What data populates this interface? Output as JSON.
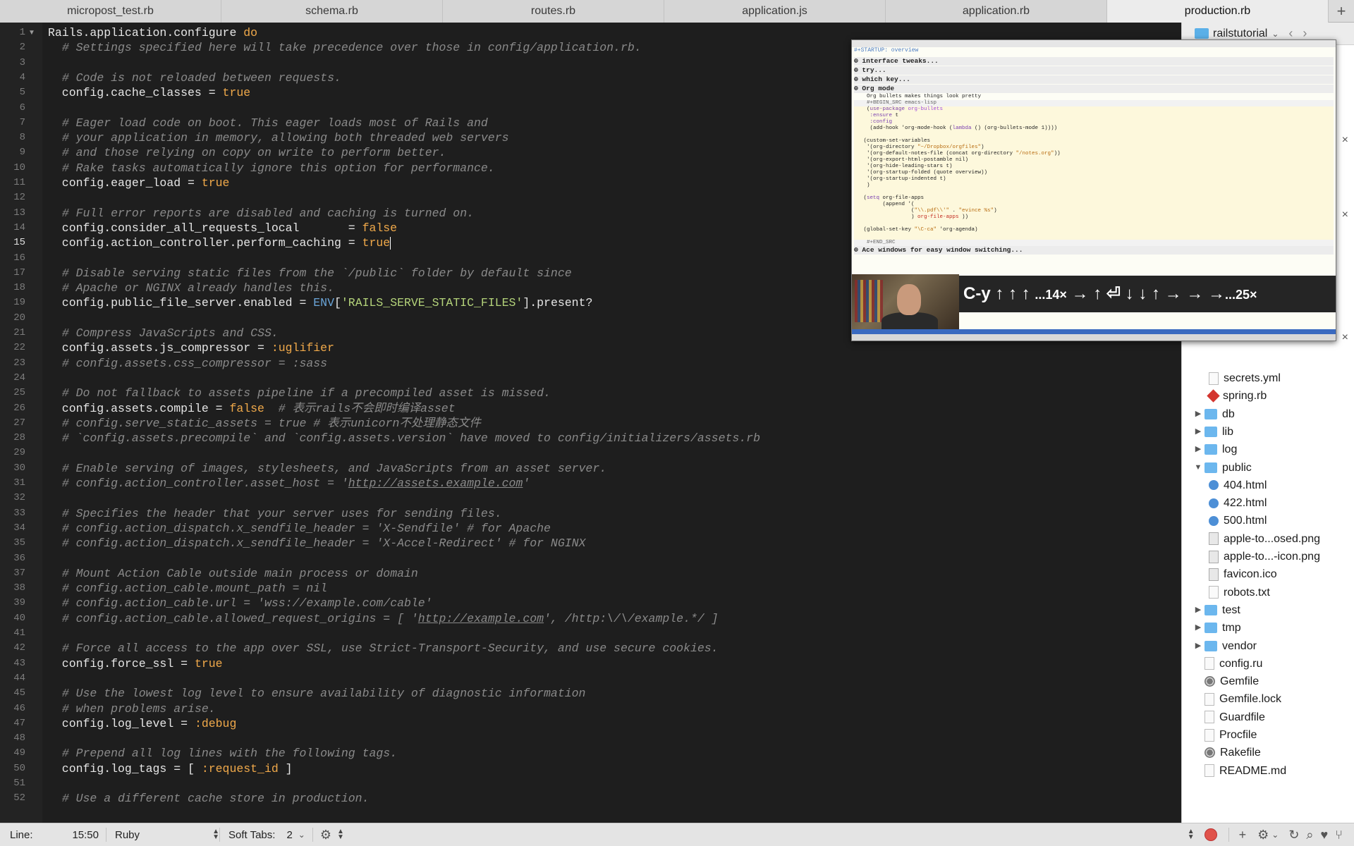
{
  "tabs": [
    {
      "label": "micropost_test.rb"
    },
    {
      "label": "schema.rb"
    },
    {
      "label": "routes.rb"
    },
    {
      "label": "application.js"
    },
    {
      "label": "application.rb"
    },
    {
      "label": "production.rb"
    }
  ],
  "active_tab": "production.rb",
  "editor": {
    "current_line": 15,
    "lines": [
      {
        "n": "1",
        "html": "Rails.application.configure <span class='kw'>do</span>"
      },
      {
        "n": "2",
        "html": "  <span class='cm'># Settings specified here will take precedence over those in config/application.rb.</span>"
      },
      {
        "n": "3",
        "html": ""
      },
      {
        "n": "4",
        "html": "  <span class='cm'># Code is not reloaded between requests.</span>"
      },
      {
        "n": "5",
        "html": "  config.cache_classes = <span class='kw'>true</span>"
      },
      {
        "n": "6",
        "html": ""
      },
      {
        "n": "7",
        "html": "  <span class='cm'># Eager load code on boot. This eager loads most of Rails and</span>"
      },
      {
        "n": "8",
        "html": "  <span class='cm'># your application in memory, allowing both threaded web servers</span>"
      },
      {
        "n": "9",
        "html": "  <span class='cm'># and those relying on copy on write to perform better.</span>"
      },
      {
        "n": "10",
        "html": "  <span class='cm'># Rake tasks automatically ignore this option for performance.</span>"
      },
      {
        "n": "11",
        "html": "  config.eager_load = <span class='kw'>true</span>"
      },
      {
        "n": "12",
        "html": ""
      },
      {
        "n": "13",
        "html": "  <span class='cm'># Full error reports are disabled and caching is turned on.</span>"
      },
      {
        "n": "14",
        "html": "  config.consider_all_requests_local       = <span class='kw'>false</span>"
      },
      {
        "n": "15",
        "html": "  config.action_controller.perform_caching = <span class='kw'>true</span><span class='caret'></span>"
      },
      {
        "n": "16",
        "html": ""
      },
      {
        "n": "17",
        "html": "  <span class='cm'># Disable serving static files from the `/public` folder by default since</span>"
      },
      {
        "n": "18",
        "html": "  <span class='cm'># Apache or NGINX already handles this.</span>"
      },
      {
        "n": "19",
        "html": "  config.public_file_server.enabled = <span class='const'>ENV</span>[<span class='str'>'RAILS_SERVE_STATIC_FILES'</span>].present?"
      },
      {
        "n": "20",
        "html": ""
      },
      {
        "n": "21",
        "html": "  <span class='cm'># Compress JavaScripts and CSS.</span>"
      },
      {
        "n": "22",
        "html": "  config.assets.js_compressor = <span class='sym'>:uglifier</span>"
      },
      {
        "n": "23",
        "html": "  <span class='cm'># config.assets.css_compressor = :sass</span>"
      },
      {
        "n": "24",
        "html": ""
      },
      {
        "n": "25",
        "html": "  <span class='cm'># Do not fallback to assets pipeline if a precompiled asset is missed.</span>"
      },
      {
        "n": "26",
        "html": "  config.assets.compile = <span class='kw'>false</span>  <span class='cm'># 表示rails不会即时编译asset</span>"
      },
      {
        "n": "27",
        "html": "  <span class='cm'># config.serve_static_assets = true # 表示unicorn不处理静态文件</span>"
      },
      {
        "n": "28",
        "html": "  <span class='cm'># `config.assets.precompile` and `config.assets.version` have moved to config/initializers/assets.rb</span>"
      },
      {
        "n": "29",
        "html": ""
      },
      {
        "n": "30",
        "html": "  <span class='cm'># Enable serving of images, stylesheets, and JavaScripts from an asset server.</span>"
      },
      {
        "n": "31",
        "html": "  <span class='cm'># config.action_controller.asset_host = '<span class='url'>http://assets.example.com</span>'</span>"
      },
      {
        "n": "32",
        "html": ""
      },
      {
        "n": "33",
        "html": "  <span class='cm'># Specifies the header that your server uses for sending files.</span>"
      },
      {
        "n": "34",
        "html": "  <span class='cm'># config.action_dispatch.x_sendfile_header = 'X-Sendfile' # for Apache</span>"
      },
      {
        "n": "35",
        "html": "  <span class='cm'># config.action_dispatch.x_sendfile_header = 'X-Accel-Redirect' # for NGINX</span>"
      },
      {
        "n": "36",
        "html": ""
      },
      {
        "n": "37",
        "html": "  <span class='cm'># Mount Action Cable outside main process or domain</span>"
      },
      {
        "n": "38",
        "html": "  <span class='cm'># config.action_cable.mount_path = nil</span>"
      },
      {
        "n": "39",
        "html": "  <span class='cm'># config.action_cable.url = 'wss://example.com/cable'</span>"
      },
      {
        "n": "40",
        "html": "  <span class='cm'># config.action_cable.allowed_request_origins = [ '<span class='url'>http://example.com</span>', /http:\\/\\/example.*/ ]</span>"
      },
      {
        "n": "41",
        "html": ""
      },
      {
        "n": "42",
        "html": "  <span class='cm'># Force all access to the app over SSL, use Strict-Transport-Security, and use secure cookies.</span>"
      },
      {
        "n": "43",
        "html": "  config.force_ssl = <span class='kw'>true</span>"
      },
      {
        "n": "44",
        "html": ""
      },
      {
        "n": "45",
        "html": "  <span class='cm'># Use the lowest log level to ensure availability of diagnostic information</span>"
      },
      {
        "n": "46",
        "html": "  <span class='cm'># when problems arise.</span>"
      },
      {
        "n": "47",
        "html": "  config.log_level = <span class='sym'>:debug</span>"
      },
      {
        "n": "48",
        "html": ""
      },
      {
        "n": "49",
        "html": "  <span class='cm'># Prepend all log lines with the following tags.</span>"
      },
      {
        "n": "50",
        "html": "  config.log_tags = [ <span class='sym'>:request_id</span> ]"
      },
      {
        "n": "51",
        "html": ""
      },
      {
        "n": "52",
        "html": "  <span class='cm'># Use a different cache store in production.</span>"
      }
    ]
  },
  "sidebar": {
    "project_name": "railstutorial",
    "items": [
      {
        "label": "secrets.yml",
        "indent": 1,
        "icon": "file"
      },
      {
        "label": "spring.rb",
        "indent": 1,
        "icon": "ruby"
      },
      {
        "label": "db",
        "indent": 0,
        "icon": "folder",
        "tri": "▶"
      },
      {
        "label": "lib",
        "indent": 0,
        "icon": "folder",
        "tri": "▶"
      },
      {
        "label": "log",
        "indent": 0,
        "icon": "folder",
        "tri": "▶"
      },
      {
        "label": "public",
        "indent": 0,
        "icon": "folder",
        "tri": "▼"
      },
      {
        "label": "404.html",
        "indent": 1,
        "icon": "html"
      },
      {
        "label": "422.html",
        "indent": 1,
        "icon": "html"
      },
      {
        "label": "500.html",
        "indent": 1,
        "icon": "html"
      },
      {
        "label": "apple-to...osed.png",
        "indent": 1,
        "icon": "img"
      },
      {
        "label": "apple-to...-icon.png",
        "indent": 1,
        "icon": "img"
      },
      {
        "label": "favicon.ico",
        "indent": 1,
        "icon": "img"
      },
      {
        "label": "robots.txt",
        "indent": 1,
        "icon": "file"
      },
      {
        "label": "test",
        "indent": 0,
        "icon": "folder",
        "tri": "▶"
      },
      {
        "label": "tmp",
        "indent": 0,
        "icon": "folder",
        "tri": "▶"
      },
      {
        "label": "vendor",
        "indent": 0,
        "icon": "folder",
        "tri": "▶"
      },
      {
        "label": "config.ru",
        "indent": 0,
        "icon": "file"
      },
      {
        "label": "Gemfile",
        "indent": 0,
        "icon": "gear"
      },
      {
        "label": "Gemfile.lock",
        "indent": 0,
        "icon": "file"
      },
      {
        "label": "Guardfile",
        "indent": 0,
        "icon": "file"
      },
      {
        "label": "Procfile",
        "indent": 0,
        "icon": "file"
      },
      {
        "label": "Rakefile",
        "indent": 0,
        "icon": "gear"
      },
      {
        "label": "README.md",
        "indent": 0,
        "icon": "file"
      }
    ]
  },
  "overlay": {
    "startup": "#+STARTUP: overview",
    "keystrokes_html": "C-y ↑ ↑ ↑ <span class='small'>...14×</span> → ↑ ⏎ ↓ ↓ ↑ → → →<span class='small'>...25×</span>",
    "lines": [
      {
        "cls": "ov-h",
        "html": "⊕ interface tweaks..."
      },
      {
        "cls": "ov-h",
        "html": "⊕ try..."
      },
      {
        "cls": "ov-h",
        "html": "⊕ which key..."
      },
      {
        "cls": "ov-h",
        "html": "⊕ Org mode"
      },
      {
        "cls": "",
        "html": "    Org bullets makes things look pretty"
      },
      {
        "cls": "ov-blk",
        "html": "    #+BEGIN_SRC emacs-lisp"
      },
      {
        "cls": "ov-src",
        "html": "    (<span class='o-kw'>use-package</span> <span class='o-fn'>org-bullets</span>"
      },
      {
        "cls": "ov-src",
        "html": "     <span class='o-kw'>:ensure</span> t"
      },
      {
        "cls": "ov-src",
        "html": "     <span class='o-kw'>:config</span>"
      },
      {
        "cls": "ov-src",
        "html": "     (add-hook 'org-mode-hook (<span class='o-kw'>lambda</span> () (org-bullets-mode 1))))"
      },
      {
        "cls": "ov-src",
        "html": ""
      },
      {
        "cls": "ov-src",
        "html": "   (custom-set-variables"
      },
      {
        "cls": "ov-src",
        "html": "    '(org-directory <span class='o-str'>\"~/Dropbox/orgfiles\"</span>)"
      },
      {
        "cls": "ov-src",
        "html": "    '(org-default-notes-file (concat org-directory <span class='o-str'>\"/notes.org\"</span>))"
      },
      {
        "cls": "ov-src",
        "html": "    '(org-export-html-postamble nil)"
      },
      {
        "cls": "ov-src",
        "html": "    '(org-hide-leading-stars t)"
      },
      {
        "cls": "ov-src",
        "html": "    '(org-startup-folded (quote overview))"
      },
      {
        "cls": "ov-src",
        "html": "    '(org-startup-indented t)"
      },
      {
        "cls": "ov-src",
        "html": "    )"
      },
      {
        "cls": "ov-src",
        "html": ""
      },
      {
        "cls": "ov-src",
        "html": "   (<span class='o-kw'>setq</span> org-file-apps"
      },
      {
        "cls": "ov-src",
        "html": "         (append '("
      },
      {
        "cls": "ov-src",
        "html": "                  (<span class='o-str'>\"\\\\.pdf\\\\'\"</span> . <span class='o-str'>\"evince %s\"</span>)"
      },
      {
        "cls": "ov-src",
        "html": "                  ) <span class='o-var'>org-file-apps</span> ))"
      },
      {
        "cls": "ov-src",
        "html": ""
      },
      {
        "cls": "ov-src",
        "html": "   (global-set-key <span class='o-str'>\"\\C-ca\"</span> 'org-agenda)"
      },
      {
        "cls": "ov-src",
        "html": ""
      },
      {
        "cls": "ov-blk",
        "html": "    #+END_SRC"
      },
      {
        "cls": "ov-h",
        "html": "⊕ Ace windows for easy window switching..."
      }
    ]
  },
  "statusbar": {
    "line_label": "Line:",
    "line_value": "15:50",
    "language": "Ruby",
    "tabs_label": "Soft Tabs:",
    "tabs_value": "2"
  },
  "colors": {
    "editor_bg": "#1e1e1e",
    "keyword": "#f0a94a",
    "comment": "#8a8a8a",
    "string": "#b4d37a",
    "sidebar_folder": "#6cb7ee"
  }
}
